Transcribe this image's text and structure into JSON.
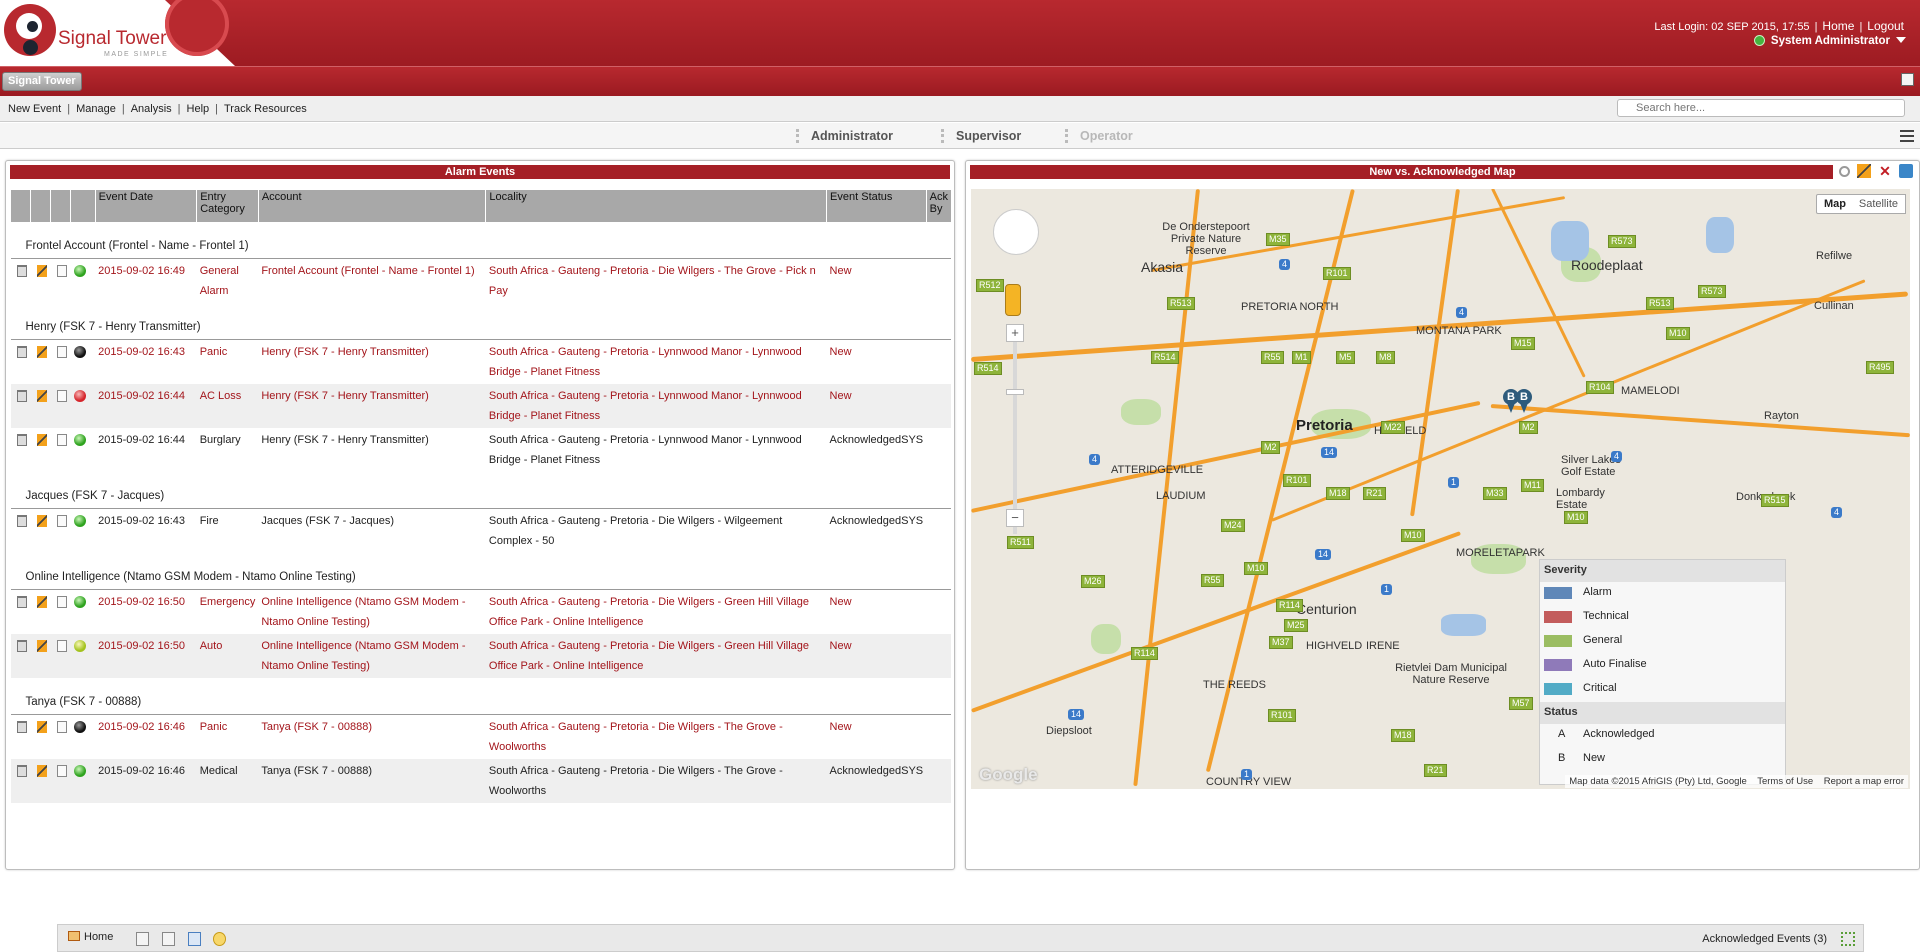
{
  "header": {
    "logo_text": "Signal Tower",
    "logo_tagline": "MADE SIMPLE",
    "last_login": "Last Login: 02 SEP 2015, 17:55",
    "home_link": "Home",
    "logout_link": "Logout",
    "user": "System Administrator"
  },
  "tabbar": {
    "app_tab": "Signal Tower"
  },
  "menu": {
    "items": [
      "New Event",
      "Manage",
      "Analysis",
      "Help",
      "Track Resources"
    ],
    "search_placeholder": "Search here..."
  },
  "roles": {
    "administrator": "Administrator",
    "supervisor": "Supervisor",
    "operator": "Operator"
  },
  "alarm_panel": {
    "title": "Alarm Events",
    "columns": [
      "Event Date",
      "Entry Category",
      "Account",
      "Locality",
      "Event Status",
      "Ack By"
    ],
    "groups": [
      {
        "name": "Frontel Account (Frontel - Name - Frontel 1)",
        "rows": [
          {
            "date": "2015-09-02 16:49",
            "category": "General Alarm",
            "account": "Frontel Account (Frontel - Name - Frontel 1)",
            "locality": "South Africa - Gauteng - Pretoria - Die Wilgers - The Grove - Pick n Pay",
            "status": "New",
            "ack_by": "",
            "led": "green",
            "new": true
          }
        ]
      },
      {
        "name": "Henry (FSK 7 - Henry Transmitter)",
        "rows": [
          {
            "date": "2015-09-02 16:43",
            "category": "Panic",
            "account": "Henry (FSK 7 - Henry Transmitter)",
            "locality": "South Africa - Gauteng - Pretoria - Lynnwood Manor - Lynnwood Bridge - Planet Fitness",
            "status": "New",
            "ack_by": "",
            "led": "black",
            "new": true
          },
          {
            "date": "2015-09-02 16:44",
            "category": "AC Loss",
            "account": "Henry (FSK 7 - Henry Transmitter)",
            "locality": "South Africa - Gauteng - Pretoria - Lynnwood Manor - Lynnwood Bridge - Planet Fitness",
            "status": "New",
            "ack_by": "",
            "led": "red",
            "new": true
          },
          {
            "date": "2015-09-02 16:44",
            "category": "Burglary",
            "account": "Henry (FSK 7 - Henry Transmitter)",
            "locality": "South Africa - Gauteng - Pretoria - Lynnwood Manor - Lynnwood Bridge - Planet Fitness",
            "status": "Acknowledged",
            "ack_by": "SYS",
            "led": "green",
            "new": false
          }
        ]
      },
      {
        "name": "Jacques (FSK 7 - Jacques)",
        "rows": [
          {
            "date": "2015-09-02 16:43",
            "category": "Fire",
            "account": "Jacques (FSK 7 - Jacques)",
            "locality": "South Africa - Gauteng - Pretoria - Die Wilgers - Wilgeement Complex - 50",
            "status": "Acknowledged",
            "ack_by": "SYS",
            "led": "green",
            "new": false
          }
        ]
      },
      {
        "name": "Online Intelligence (Ntamo GSM Modem - Ntamo Online Testing)",
        "rows": [
          {
            "date": "2015-09-02 16:50",
            "category": "Emergency",
            "account": "Online Intelligence (Ntamo GSM Modem - Ntamo Online Testing)",
            "locality": "South Africa - Gauteng - Pretoria - Die Wilgers - Green Hill Village Office Park - Online Intelligence",
            "status": "New",
            "ack_by": "",
            "led": "green",
            "new": true
          },
          {
            "date": "2015-09-02 16:50",
            "category": "Auto",
            "account": "Online Intelligence (Ntamo GSM Modem - Ntamo Online Testing)",
            "locality": "South Africa - Gauteng - Pretoria - Die Wilgers - Green Hill Village Office Park - Online Intelligence",
            "status": "New",
            "ack_by": "",
            "led": "yellow",
            "new": true
          }
        ]
      },
      {
        "name": "Tanya (FSK 7 - 00888)",
        "rows": [
          {
            "date": "2015-09-02 16:46",
            "category": "Panic",
            "account": "Tanya (FSK 7 - 00888)",
            "locality": "South Africa - Gauteng - Pretoria - Die Wilgers - The Grove - Woolworths",
            "status": "New",
            "ack_by": "",
            "led": "black",
            "new": true
          },
          {
            "date": "2015-09-02 16:46",
            "category": "Medical",
            "account": "Tanya (FSK 7 - 00888)",
            "locality": "South Africa - Gauteng - Pretoria - Die Wilgers - The Grove - Woolworths",
            "status": "Acknowledged",
            "ack_by": "SYS",
            "led": "green",
            "new": false
          }
        ]
      }
    ]
  },
  "map_panel": {
    "title": "New vs. Acknowledged Map",
    "map_button": "Map",
    "satellite_button": "Satellite",
    "zoom_in": "+",
    "zoom_out": "−",
    "places": [
      "De Onderstepoort Private Nature Reserve",
      "Akasia",
      "PRETORIA NORTH",
      "MONTANA PARK",
      "Roodeplaat",
      "Refilwe",
      "Cullinan",
      "MAMELODI",
      "Pretoria",
      "HATFIELD",
      "ATTERIDGEVILLE",
      "LAUDIUM",
      "Silver Lakes Golf Estate",
      "Lombardy Estate",
      "Rayton",
      "Donkerhoek",
      "MORELETAPARK",
      "Centurion",
      "HIGHVELD",
      "IRENE",
      "Rietvlei Dam Municipal Nature Reserve",
      "THE REEDS",
      "Diepsloot",
      "COUNTRY VIEW"
    ],
    "pins": [
      "B",
      "B"
    ],
    "legend": {
      "severity_title": "Severity",
      "severity": [
        {
          "label": "Alarm",
          "color": "#5f87b8"
        },
        {
          "label": "Technical",
          "color": "#c35c5c"
        },
        {
          "label": "General",
          "color": "#9bbd62"
        },
        {
          "label": "Auto Finalise",
          "color": "#8f7ab9"
        },
        {
          "label": "Critical",
          "color": "#52abc6"
        }
      ],
      "status_title": "Status",
      "status": [
        {
          "key": "A",
          "label": "Acknowledged"
        },
        {
          "key": "B",
          "label": "New"
        }
      ]
    },
    "attribution": "Map data ©2015 AfriGIS (Pty) Ltd, Google",
    "terms": "Terms of Use",
    "report": "Report a map error",
    "google": "Google"
  },
  "footer": {
    "home": "Home",
    "ack_events": "Acknowledged Events (3)"
  }
}
